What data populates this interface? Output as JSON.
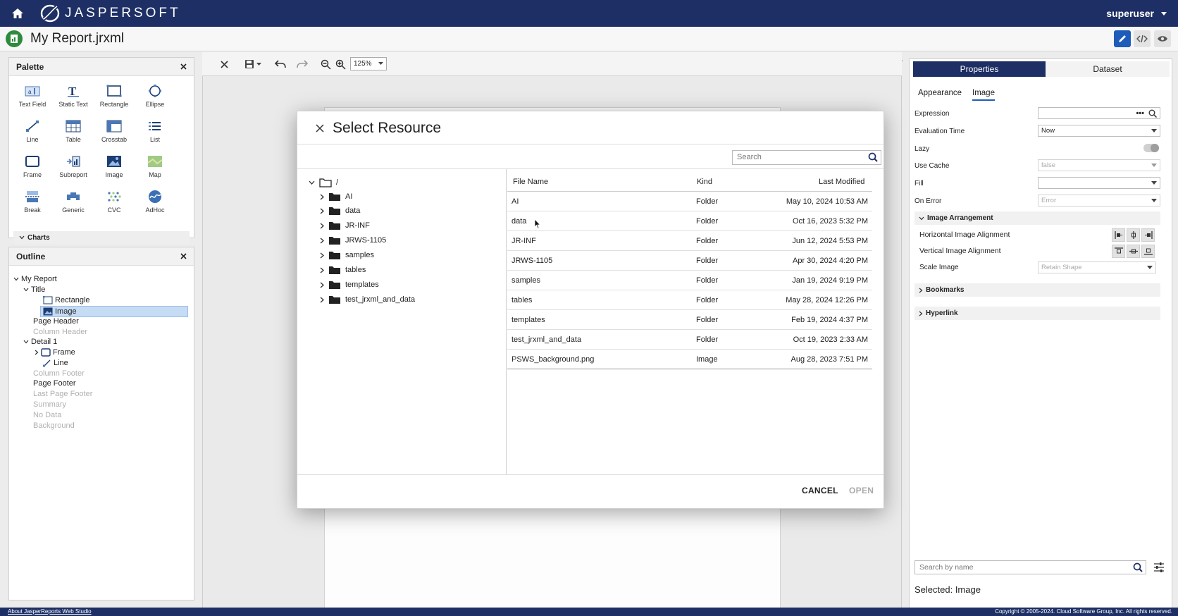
{
  "app": {
    "brand": "JASPERSOFT",
    "user": "superuser",
    "report_title": "My Report.jrxml"
  },
  "colors": {
    "navy": "#1d2f64",
    "accent_blue": "#1d5cb8",
    "selected_row": "#c6dcf5",
    "report_green": "#2e8b3d"
  },
  "palette": {
    "title": "Palette",
    "items": [
      {
        "label": "Text Field",
        "icon": "text-field-icon"
      },
      {
        "label": "Static Text",
        "icon": "static-text-icon"
      },
      {
        "label": "Rectangle",
        "icon": "rectangle-icon"
      },
      {
        "label": "Ellipse",
        "icon": "ellipse-icon"
      },
      {
        "label": "Line",
        "icon": "line-icon"
      },
      {
        "label": "Table",
        "icon": "table-icon"
      },
      {
        "label": "Crosstab",
        "icon": "crosstab-icon"
      },
      {
        "label": "List",
        "icon": "list-icon"
      },
      {
        "label": "Frame",
        "icon": "frame-icon"
      },
      {
        "label": "Subreport",
        "icon": "subreport-icon"
      },
      {
        "label": "Image",
        "icon": "image-icon"
      },
      {
        "label": "Map",
        "icon": "map-icon"
      },
      {
        "label": "Break",
        "icon": "break-icon"
      },
      {
        "label": "Generic",
        "icon": "generic-icon"
      },
      {
        "label": "CVC",
        "icon": "cvc-icon"
      },
      {
        "label": "AdHoc",
        "icon": "adhoc-icon"
      }
    ],
    "charts_label": "Charts"
  },
  "outline": {
    "title": "Outline",
    "items": [
      "My Report",
      "Title",
      "Rectangle",
      "Image",
      "Page Header",
      "Column Header",
      "Detail 1",
      "Frame",
      "Line",
      "Column Footer",
      "Page Footer",
      "Last Page Footer",
      "Summary",
      "No Data",
      "Background"
    ]
  },
  "toolbar": {
    "zoom": "125%"
  },
  "properties": {
    "tabs": [
      "Properties",
      "Dataset"
    ],
    "subtabs": [
      "Appearance",
      "Image"
    ],
    "fields": [
      {
        "label": "Expression",
        "value": "•••"
      },
      {
        "label": "Evaluation Time",
        "value": "Now"
      },
      {
        "label": "Lazy",
        "value": ""
      },
      {
        "label": "Use Cache",
        "value": "false"
      },
      {
        "label": "Fill",
        "value": ""
      },
      {
        "label": "On Error",
        "value": "Error"
      }
    ],
    "image_arrangement": {
      "label": "Image Arrangement",
      "horizontal": "Horizontal Image Alignment",
      "vertical": "Vertical Image Alignment",
      "scale_label": "Scale Image",
      "scale_value": "Retain Shape"
    },
    "bookmarks": "Bookmarks",
    "hyperlink": "Hyperlink",
    "search_placeholder": "Search by name",
    "selected": "Selected: Image"
  },
  "modal": {
    "title": "Select Resource",
    "search_placeholder": "Search",
    "root": "/",
    "folders": [
      "AI",
      "data",
      "JR-INF",
      "JRWS-1105",
      "samples",
      "tables",
      "templates",
      "test_jrxml_and_data"
    ],
    "columns": [
      "File Name",
      "Kind",
      "Last Modified"
    ],
    "rows": [
      {
        "name": "AI",
        "kind": "Folder",
        "modified": "May 10, 2024 10:53 AM"
      },
      {
        "name": "data",
        "kind": "Folder",
        "modified": "Oct 16, 2023 5:32 PM"
      },
      {
        "name": "JR-INF",
        "kind": "Folder",
        "modified": "Jun 12, 2024 5:53 PM"
      },
      {
        "name": "JRWS-1105",
        "kind": "Folder",
        "modified": "Apr 30, 2024 4:20 PM"
      },
      {
        "name": "samples",
        "kind": "Folder",
        "modified": "Jan 19, 2024 9:19 PM"
      },
      {
        "name": "tables",
        "kind": "Folder",
        "modified": "May 28, 2024 12:26 PM"
      },
      {
        "name": "templates",
        "kind": "Folder",
        "modified": "Feb 19, 2024 4:37 PM"
      },
      {
        "name": "test_jrxml_and_data",
        "kind": "Folder",
        "modified": "Oct 19, 2023 2:33 AM"
      },
      {
        "name": "PSWS_background.png",
        "kind": "Image",
        "modified": "Aug 28, 2023 7:51 PM"
      }
    ],
    "cancel": "CANCEL",
    "open": "OPEN"
  },
  "footer": {
    "about": "About JasperReports Web Studio",
    "copyright": "Copyright © 2005-2024. Cloud Software Group, Inc. All rights reserved."
  }
}
